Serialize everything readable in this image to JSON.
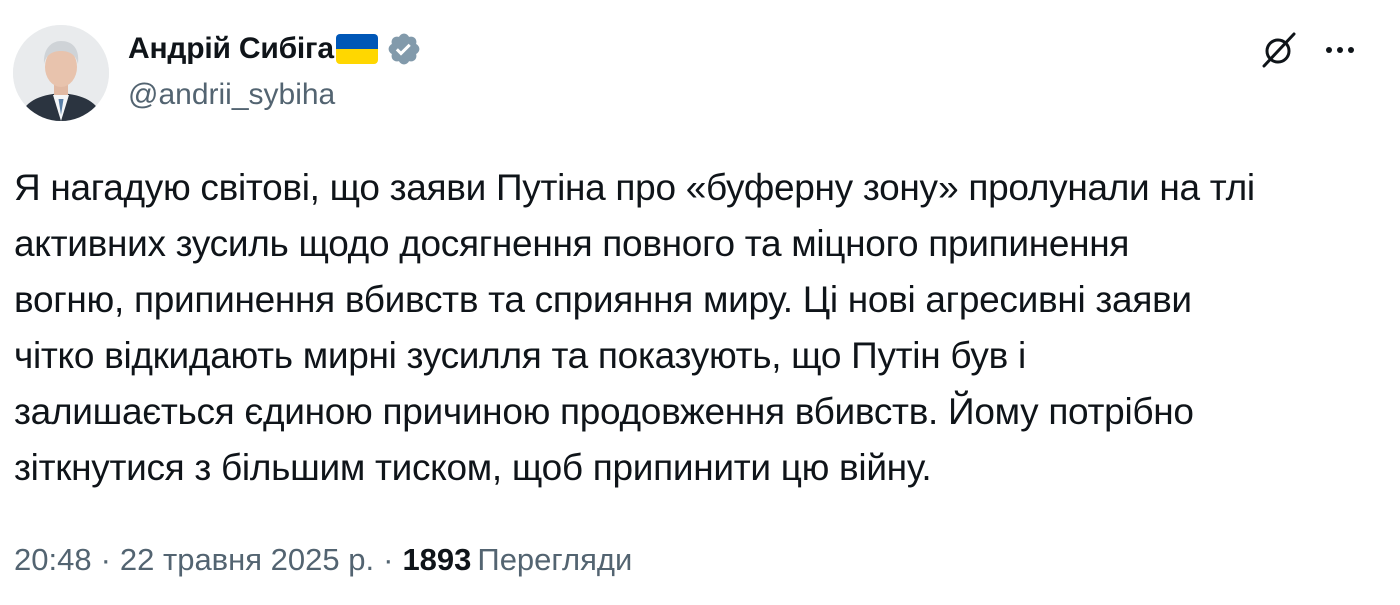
{
  "author": {
    "display_name": "Андрій Сибіга",
    "handle": "@andrii_sybiha",
    "flag_icon": "ukraine-flag-emoji",
    "verified_icon": "grey-verified-badge",
    "verified_color": "#829aab"
  },
  "actions": {
    "grok_icon": "grok-icon",
    "more_icon": "more-horizontal-icon"
  },
  "tweet": {
    "lines": [
      "Я нагадую світові, що заяви Путіна про «буферну зону» пролунали на тлі",
      "активних зусиль щодо досягнення повного та міцного припинення",
      "вогню, припинення вбивств та сприяння миру. Ці нові агресивні заяви",
      "чітко відкидають мирні зусилля та показують, що Путін був і",
      "залишається єдиною причиною продовження вбивств. Йому потрібно",
      "зіткнутися з більшим тиском, щоб припинити цю війну."
    ]
  },
  "meta": {
    "time": "20:48",
    "separator": "·",
    "date": "22 травня 2025 р.",
    "views_count": "1893",
    "views_label": "Перегляди"
  },
  "colors": {
    "text_primary": "#0f1419",
    "text_secondary": "#536471",
    "flag_blue": "#0057b7",
    "flag_yellow": "#ffd700"
  }
}
